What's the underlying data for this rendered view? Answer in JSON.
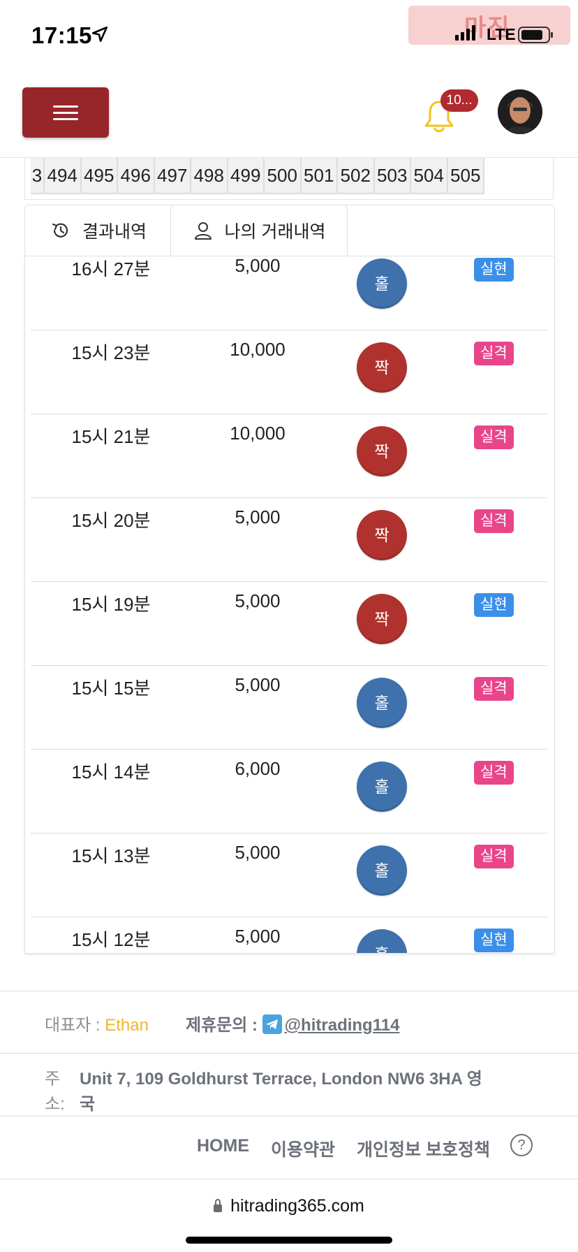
{
  "status_bar": {
    "time": "17:15",
    "network": "LTE",
    "watermark": "마진"
  },
  "header": {
    "notification_count": "10..."
  },
  "number_strip": [
    "3",
    "494",
    "495",
    "496",
    "497",
    "498",
    "499",
    "500",
    "501",
    "502",
    "503",
    "504",
    "505"
  ],
  "tabs": [
    {
      "label": "결과내역",
      "icon": "history-icon",
      "active": false
    },
    {
      "label": "나의 거래내역",
      "icon": "user-icon",
      "active": true
    }
  ],
  "trades": [
    {
      "time": "16시 27분",
      "amount": "5,000",
      "pick": "홀",
      "pick_type": "odd",
      "result": "실현",
      "result_type": "realized"
    },
    {
      "time": "15시 23분",
      "amount": "10,000",
      "pick": "짝",
      "pick_type": "even",
      "result": "실격",
      "result_type": "disqualified"
    },
    {
      "time": "15시 21분",
      "amount": "10,000",
      "pick": "짝",
      "pick_type": "even",
      "result": "실격",
      "result_type": "disqualified"
    },
    {
      "time": "15시 20분",
      "amount": "5,000",
      "pick": "짝",
      "pick_type": "even",
      "result": "실격",
      "result_type": "disqualified"
    },
    {
      "time": "15시 19분",
      "amount": "5,000",
      "pick": "짝",
      "pick_type": "even",
      "result": "실현",
      "result_type": "realized"
    },
    {
      "time": "15시 15분",
      "amount": "5,000",
      "pick": "홀",
      "pick_type": "odd",
      "result": "실격",
      "result_type": "disqualified"
    },
    {
      "time": "15시 14분",
      "amount": "6,000",
      "pick": "홀",
      "pick_type": "odd",
      "result": "실격",
      "result_type": "disqualified"
    },
    {
      "time": "15시 13분",
      "amount": "5,000",
      "pick": "홀",
      "pick_type": "odd",
      "result": "실격",
      "result_type": "disqualified"
    },
    {
      "time": "15시 12분",
      "amount": "5,000",
      "pick": "홀",
      "pick_type": "odd",
      "result": "실현",
      "result_type": "realized"
    }
  ],
  "colors": {
    "odd_ball": "#3f72ad",
    "even_ball": "#b0322f",
    "realized_badge": "#3b8fe8",
    "disqualified_badge": "#e8458b",
    "menu_button": "#97262a",
    "ceo_name": "#f0b52a"
  },
  "footer": {
    "ceo_label": "대표자 : ",
    "ceo_name": "Ethan",
    "contact_label": "제휴문의 : ",
    "contact_handle": "@hitrading114",
    "address_label_1": "주",
    "address_label_2": "소:",
    "address_line_1": "Unit 7, 109 Goldhurst Terrace, London NW6 3HA 영",
    "address_line_2": "국",
    "nav": {
      "home": "HOME",
      "terms": "이용약관",
      "privacy": "개인정보 보호정책",
      "help": "?"
    }
  },
  "browser": {
    "url": "hitrading365.com"
  }
}
